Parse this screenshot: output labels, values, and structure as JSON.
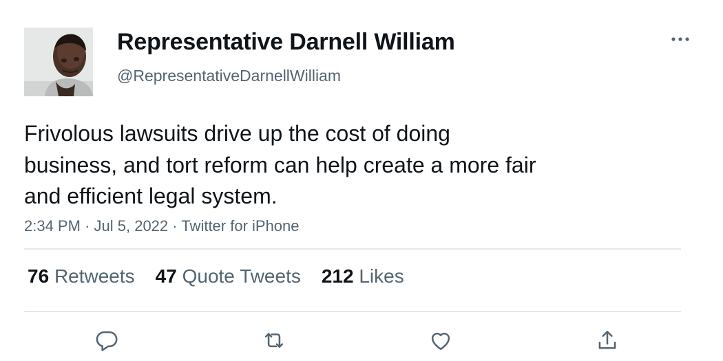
{
  "author": {
    "name": "Representative Darnell William",
    "handle": "@RepresentativeDarnellWilliam",
    "avatar_icon": "profile-photo"
  },
  "tweet": {
    "text": "Frivolous lawsuits drive up the cost of doing\nbusiness, and tort reform can help create a more fair\nand efficient legal system.",
    "time": "2:34 PM",
    "separator": "·",
    "date": "Jul 5, 2022",
    "source": "Twitter for iPhone"
  },
  "stats": {
    "retweets": {
      "count": "76",
      "label": "Retweets"
    },
    "quotes": {
      "count": "47",
      "label": "Quote Tweets"
    },
    "likes": {
      "count": "212",
      "label": "Likes"
    }
  },
  "actions": [
    "reply-icon",
    "retweet-icon",
    "like-icon",
    "share-icon"
  ],
  "colors": {
    "text": "#0f1419",
    "secondary": "#536471",
    "divider": "#e4e8eb"
  }
}
